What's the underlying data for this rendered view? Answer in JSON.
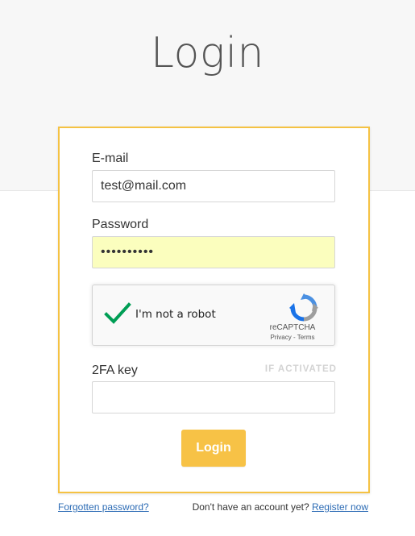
{
  "page": {
    "title": "Login"
  },
  "form": {
    "email": {
      "label": "E-mail",
      "value": "test@mail.com"
    },
    "password": {
      "label": "Password",
      "value": "••••••••••"
    },
    "captcha": {
      "label": "I'm not a robot",
      "brand": "reCAPTCHA",
      "privacy_label": "Privacy",
      "separator": " - ",
      "terms_label": "Terms",
      "checked": true
    },
    "twofa": {
      "label": "2FA key",
      "hint": "IF ACTIVATED",
      "value": ""
    },
    "submit_label": "Login"
  },
  "footer": {
    "forgot_label": "Forgotten password?",
    "no_account_text": "Don't have an account yet? ",
    "register_label": "Register now"
  },
  "colors": {
    "accent": "#f7c246",
    "card_border": "#f5c243",
    "link": "#2d6cb5",
    "autofill_bg": "#fbfebe",
    "check_green": "#009e55"
  }
}
